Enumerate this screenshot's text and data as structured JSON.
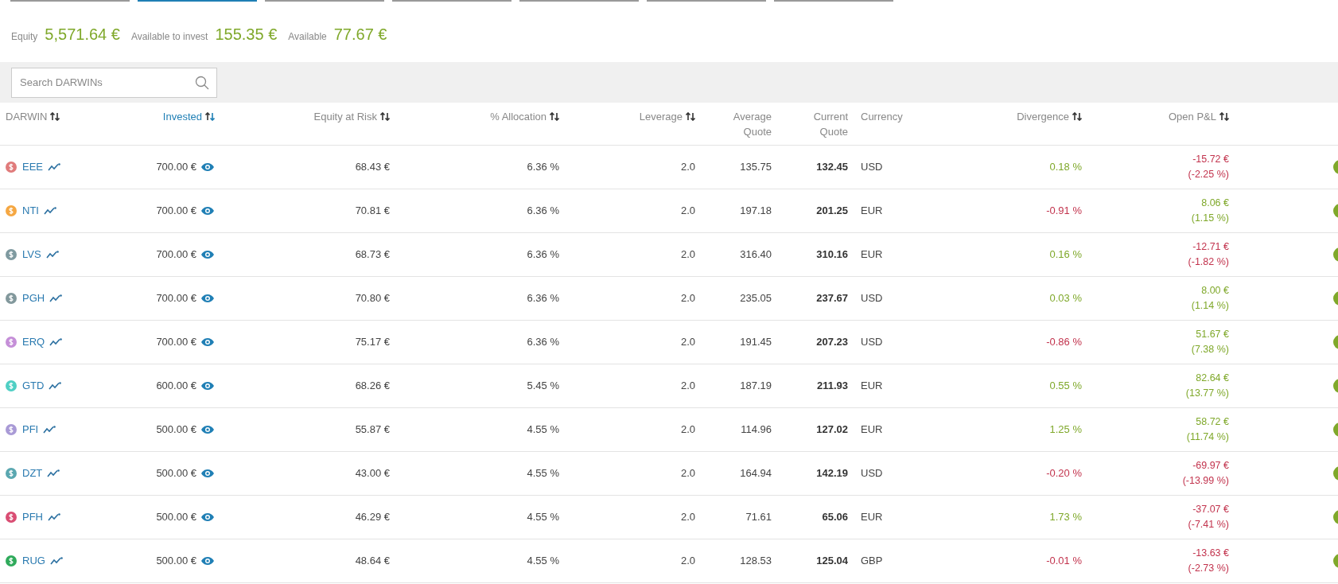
{
  "tabs": [
    {
      "selected": false
    },
    {
      "selected": true
    },
    {
      "selected": false
    },
    {
      "selected": false
    },
    {
      "selected": false
    },
    {
      "selected": false
    },
    {
      "selected": false
    }
  ],
  "summary": [
    {
      "label": "Equity",
      "value": "5,571.64 €"
    },
    {
      "label": "Available to invest",
      "value": "155.35 €"
    },
    {
      "label": "Available",
      "value": "77.67 €"
    }
  ],
  "search": {
    "placeholder": "Search DARWINs"
  },
  "columns": [
    {
      "label": "DARWIN",
      "sortable": true,
      "selected": false
    },
    {
      "label": "Invested",
      "sortable": true,
      "selected": true
    },
    {
      "label": "Equity at Risk",
      "sortable": true,
      "selected": false
    },
    {
      "label": "% Allocation",
      "sortable": true,
      "selected": false
    },
    {
      "label": "Leverage",
      "sortable": true,
      "selected": false
    },
    {
      "label": "Average Quote",
      "sortable": false,
      "selected": false
    },
    {
      "label": "Current Quote",
      "sortable": false,
      "selected": false
    },
    {
      "label": "Currency",
      "sortable": false,
      "selected": false
    },
    {
      "label": "Divergence",
      "sortable": true,
      "selected": false
    },
    {
      "label": "Open P&L",
      "sortable": true,
      "selected": false
    }
  ],
  "rows": [
    {
      "darwin": "EEE",
      "color": "#e07b7b",
      "invested": "700.00 €",
      "equity_at_risk": "68.43 €",
      "allocation": "6.36 %",
      "leverage": "2.0",
      "average_quote": "135.75",
      "current_quote": "132.45",
      "currency": "USD",
      "divergence": "0.18 %",
      "divergence_positive": true,
      "pnl": "-15.72 €",
      "pnl_percent": "(-2.25 %)",
      "pnl_positive": false
    },
    {
      "darwin": "NTI",
      "color": "#f5a742",
      "invested": "700.00 €",
      "equity_at_risk": "70.81 €",
      "allocation": "6.36 %",
      "leverage": "2.0",
      "average_quote": "197.18",
      "current_quote": "201.25",
      "currency": "EUR",
      "divergence": "-0.91 %",
      "divergence_positive": false,
      "pnl": "8.06 €",
      "pnl_percent": "(1.15 %)",
      "pnl_positive": true
    },
    {
      "darwin": "LVS",
      "color": "#7f9aa0",
      "invested": "700.00 €",
      "equity_at_risk": "68.73 €",
      "allocation": "6.36 %",
      "leverage": "2.0",
      "average_quote": "316.40",
      "current_quote": "310.16",
      "currency": "EUR",
      "divergence": "0.16 %",
      "divergence_positive": true,
      "pnl": "-12.71 €",
      "pnl_percent": "(-1.82 %)",
      "pnl_positive": false
    },
    {
      "darwin": "PGH",
      "color": "#82989c",
      "invested": "700.00 €",
      "equity_at_risk": "70.80 €",
      "allocation": "6.36 %",
      "leverage": "2.0",
      "average_quote": "235.05",
      "current_quote": "237.67",
      "currency": "USD",
      "divergence": "0.03 %",
      "divergence_positive": true,
      "pnl": "8.00 €",
      "pnl_percent": "(1.14 %)",
      "pnl_positive": true
    },
    {
      "darwin": "ERQ",
      "color": "#c58fd8",
      "invested": "700.00 €",
      "equity_at_risk": "75.17 €",
      "allocation": "6.36 %",
      "leverage": "2.0",
      "average_quote": "191.45",
      "current_quote": "207.23",
      "currency": "USD",
      "divergence": "-0.86 %",
      "divergence_positive": false,
      "pnl": "51.67 €",
      "pnl_percent": "(7.38 %)",
      "pnl_positive": true
    },
    {
      "darwin": "GTD",
      "color": "#4fcfc4",
      "invested": "600.00 €",
      "equity_at_risk": "68.26 €",
      "allocation": "5.45 %",
      "leverage": "2.0",
      "average_quote": "187.19",
      "current_quote": "211.93",
      "currency": "EUR",
      "divergence": "0.55 %",
      "divergence_positive": true,
      "pnl": "82.64 €",
      "pnl_percent": "(13.77 %)",
      "pnl_positive": true
    },
    {
      "darwin": "PFI",
      "color": "#a99ad6",
      "invested": "500.00 €",
      "equity_at_risk": "55.87 €",
      "allocation": "4.55 %",
      "leverage": "2.0",
      "average_quote": "114.96",
      "current_quote": "127.02",
      "currency": "EUR",
      "divergence": "1.25 %",
      "divergence_positive": true,
      "pnl": "58.72 €",
      "pnl_percent": "(11.74 %)",
      "pnl_positive": true
    },
    {
      "darwin": "DZT",
      "color": "#5aa7b0",
      "invested": "500.00 €",
      "equity_at_risk": "43.00 €",
      "allocation": "4.55 %",
      "leverage": "2.0",
      "average_quote": "164.94",
      "current_quote": "142.19",
      "currency": "USD",
      "divergence": "-0.20 %",
      "divergence_positive": false,
      "pnl": "-69.97 €",
      "pnl_percent": "(-13.99 %)",
      "pnl_positive": false
    },
    {
      "darwin": "PFH",
      "color": "#d94d73",
      "invested": "500.00 €",
      "equity_at_risk": "46.29 €",
      "allocation": "4.55 %",
      "leverage": "2.0",
      "average_quote": "71.61",
      "current_quote": "65.06",
      "currency": "EUR",
      "divergence": "1.73 %",
      "divergence_positive": true,
      "pnl": "-37.07 €",
      "pnl_percent": "(-7.41 %)",
      "pnl_positive": false
    },
    {
      "darwin": "RUG",
      "color": "#2faa5b",
      "invested": "500.00 €",
      "equity_at_risk": "48.64 €",
      "allocation": "4.55 %",
      "leverage": "2.0",
      "average_quote": "128.53",
      "current_quote": "125.04",
      "currency": "GBP",
      "divergence": "-0.01 %",
      "divergence_positive": false,
      "pnl": "-13.63 €",
      "pnl_percent": "(-2.73 %)",
      "pnl_positive": false
    }
  ]
}
